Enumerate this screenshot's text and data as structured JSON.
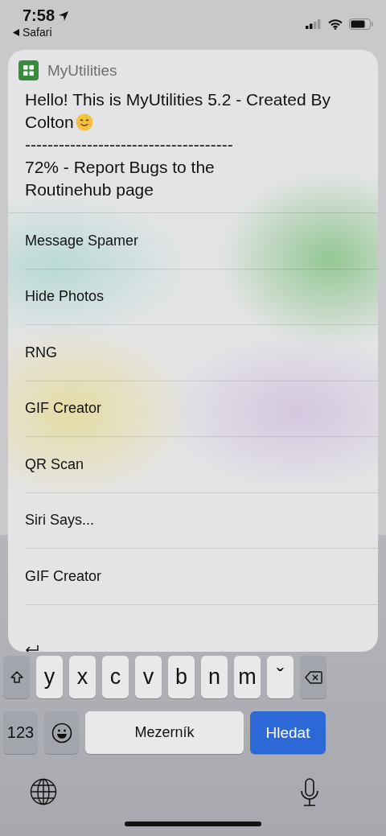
{
  "status_bar": {
    "time": "7:58",
    "back_app": "Safari"
  },
  "shortcut_menu": {
    "title": "MyUtilities",
    "message": [
      "Hello! This is MyUtilities 5.2 - Created By Colton",
      "-------------------------------------",
      "72% - Report Bugs to the\nRoutinehub page"
    ],
    "items": [
      {
        "kind": "text",
        "label": "Message Spamer"
      },
      {
        "kind": "text",
        "label": "Hide Photos"
      },
      {
        "kind": "text",
        "label": "RNG"
      },
      {
        "kind": "text",
        "label": "GIF Creator"
      },
      {
        "kind": "text",
        "label": "QR Scan"
      },
      {
        "kind": "text",
        "label": "Siri Says..."
      },
      {
        "kind": "text",
        "label": "GIF Creator"
      },
      {
        "kind": "return"
      }
    ]
  },
  "keyboard": {
    "letters": [
      "y",
      "x",
      "c",
      "v",
      "b",
      "n",
      "m",
      "ˇ"
    ],
    "numbers_key": "123",
    "space_key": "Mezerník",
    "action_key": "Hledat"
  }
}
